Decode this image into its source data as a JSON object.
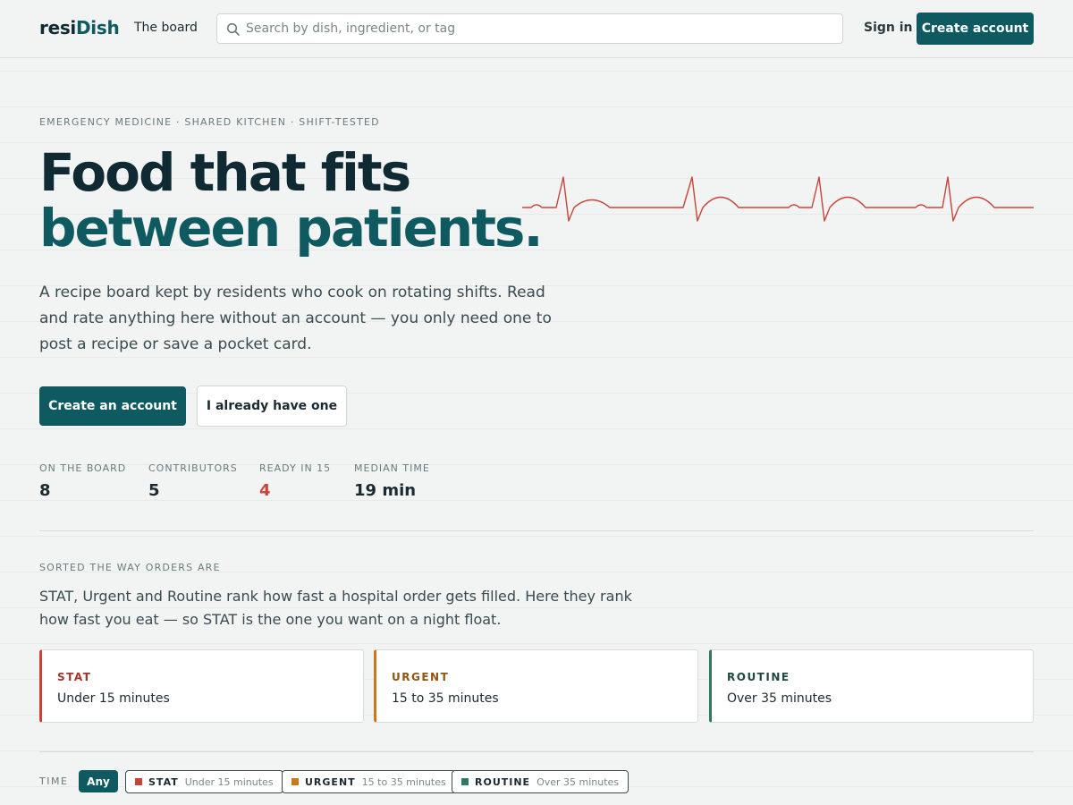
{
  "header": {
    "logo_part1": "resi",
    "logo_part2": "Dish",
    "nav_board": "The board",
    "search_placeholder": "Search by dish, ingredient, or tag",
    "signin": "Sign in",
    "create_account": "Create account"
  },
  "hero": {
    "eyebrow": "EMERGENCY MEDICINE · SHARED KITCHEN · SHIFT-TESTED",
    "title_line1": "Food that fits",
    "title_line2": "between patients.",
    "lede": "A recipe board kept by residents who cook on rotating shifts. Read and rate anything here without an account — you only need one to post a recipe or save a pocket card.",
    "primary_cta": "Create an account",
    "secondary_cta": "I already have one"
  },
  "stats": [
    {
      "label": "ON THE BOARD",
      "value": "8"
    },
    {
      "label": "CONTRIBUTORS",
      "value": "5"
    },
    {
      "label": "READY IN 15",
      "value": "4"
    },
    {
      "label": "MEDIAN TIME",
      "value": "19 min"
    }
  ],
  "sorted": {
    "eyebrow": "SORTED THE WAY ORDERS ARE",
    "text": "STAT, Urgent and Routine rank how fast a hospital order gets filled. Here they rank how fast you eat — so STAT is the one you want on a night float."
  },
  "tiers": [
    {
      "name": "STAT",
      "desc": "Under 15 minutes"
    },
    {
      "name": "URGENT",
      "desc": "15 to 35 minutes"
    },
    {
      "name": "ROUTINE",
      "desc": "Over 35 minutes"
    }
  ],
  "filter": {
    "label": "TIME",
    "any": "Any",
    "chips": [
      {
        "name": "STAT",
        "desc": "Under 15 minutes"
      },
      {
        "name": "URGENT",
        "desc": "15 to 35 minutes"
      },
      {
        "name": "ROUTINE",
        "desc": "Over 35 minutes"
      }
    ]
  },
  "colors": {
    "brand": "#0f5a60",
    "ink": "#0f2a33",
    "stat": "#c8443a",
    "urgent": "#c9781e",
    "routine": "#2f7a5c"
  }
}
